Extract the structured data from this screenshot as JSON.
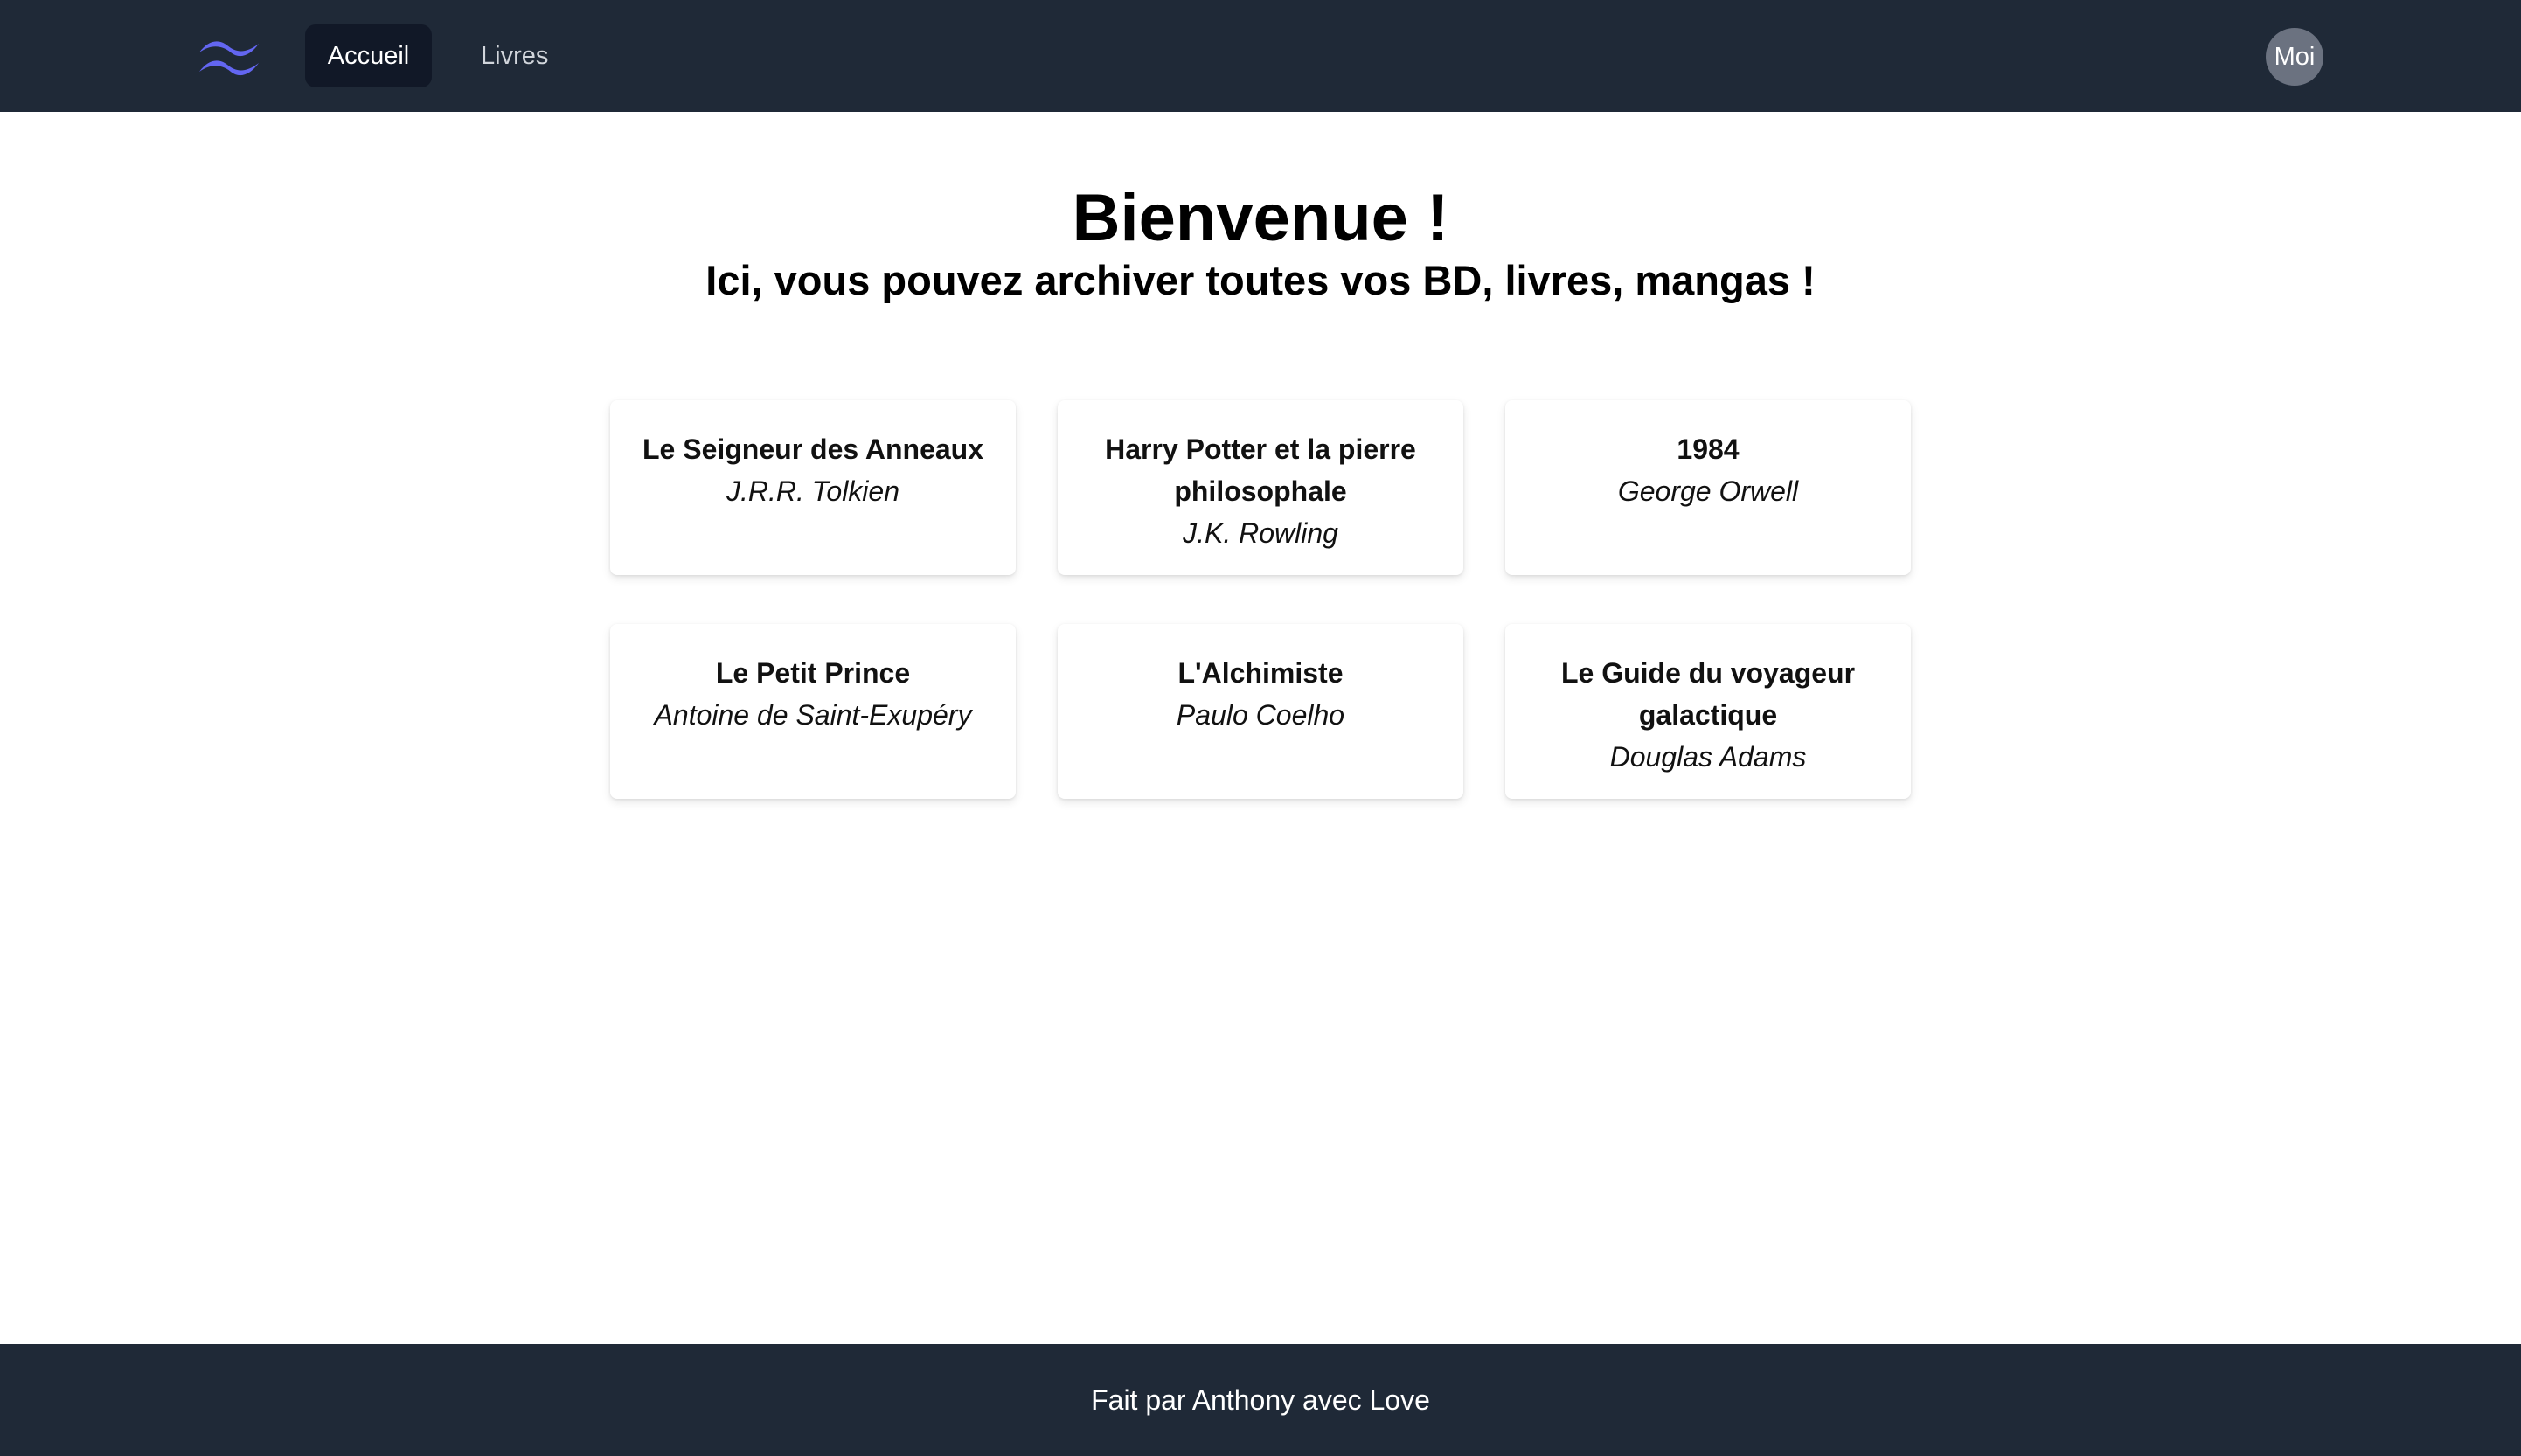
{
  "nav": {
    "logo_icon": "tailwind-wave-logo",
    "items": [
      {
        "label": "Accueil",
        "active": true
      },
      {
        "label": "Livres",
        "active": false
      }
    ],
    "avatar_label": "Moi"
  },
  "hero": {
    "title": "Bienvenue !",
    "subtitle": "Ici, vous pouvez archiver toutes vos BD, livres, mangas !"
  },
  "books": [
    {
      "title": "Le Seigneur des Anneaux",
      "author": "J.R.R. Tolkien"
    },
    {
      "title": "Harry Potter et la pierre philosophale",
      "author": "J.K. Rowling"
    },
    {
      "title": "1984",
      "author": "George Orwell"
    },
    {
      "title": "Le Petit Prince",
      "author": "Antoine de Saint-Exupéry"
    },
    {
      "title": "L'Alchimiste",
      "author": "Paulo Coelho"
    },
    {
      "title": "Le Guide du voyageur galactique",
      "author": "Douglas Adams"
    }
  ],
  "footer": {
    "text": "Fait par Anthony avec Love"
  },
  "colors": {
    "navbar_bg": "#1f2937",
    "nav_active_bg": "#111827",
    "logo": "#6366f1",
    "avatar_bg": "#6b7280"
  }
}
